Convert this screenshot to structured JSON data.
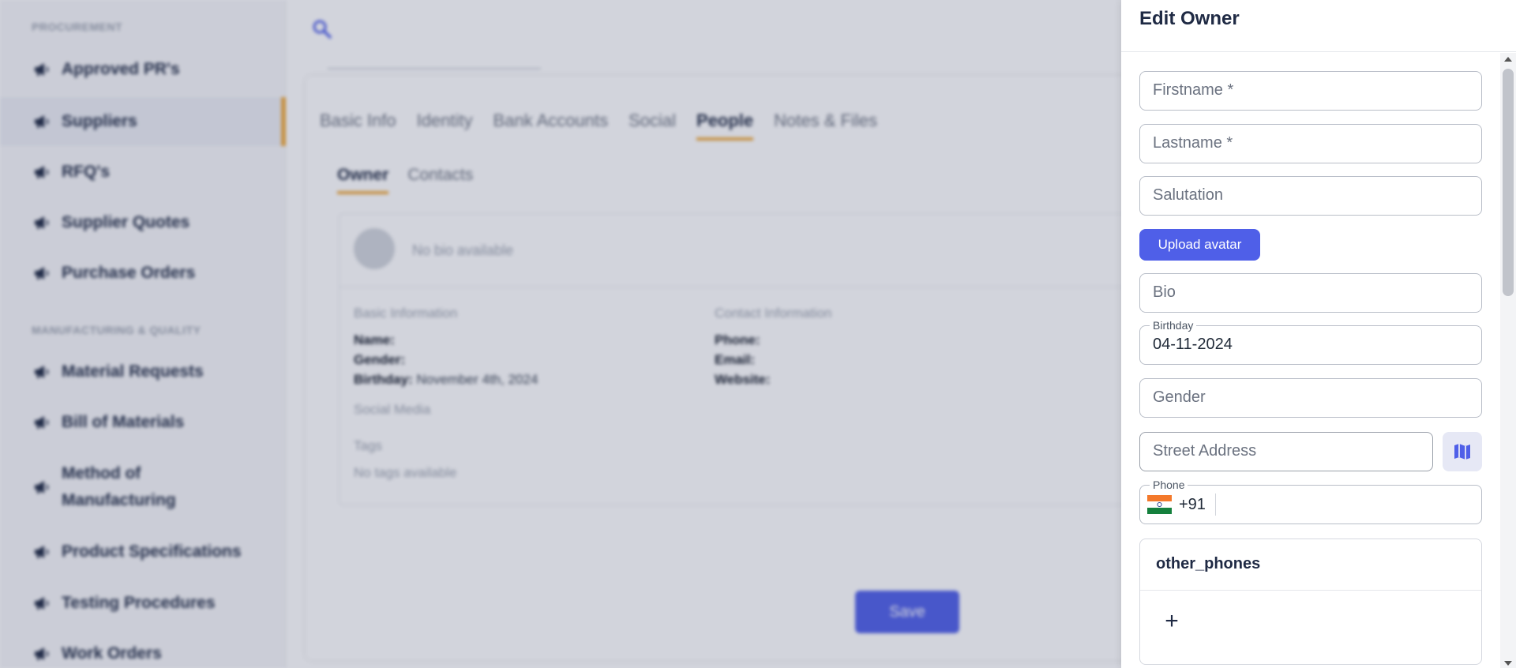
{
  "sidebar": {
    "section_procurement": "PROCUREMENT",
    "section_manufacturing": "MANUFACTURING & QUALITY",
    "items": [
      {
        "label": "Approved PR's"
      },
      {
        "label": "Suppliers"
      },
      {
        "label": "RFQ's"
      },
      {
        "label": "Supplier Quotes"
      },
      {
        "label": "Purchase Orders"
      },
      {
        "label": "Material Requests"
      },
      {
        "label": "Bill of Materials"
      },
      {
        "label": "Method of Manufacturing"
      },
      {
        "label": "Product Specifications"
      },
      {
        "label": "Testing Procedures"
      },
      {
        "label": "Work Orders"
      }
    ],
    "active_item": "Suppliers"
  },
  "main": {
    "tabs": [
      {
        "label": "Basic Info"
      },
      {
        "label": "Identity"
      },
      {
        "label": "Bank Accounts"
      },
      {
        "label": "Social"
      },
      {
        "label": "People"
      },
      {
        "label": "Notes & Files"
      }
    ],
    "active_tab": "People",
    "subtabs": [
      {
        "label": "Owner"
      },
      {
        "label": "Contacts"
      }
    ],
    "active_subtab": "Owner",
    "profile": {
      "no_bio": "No bio available",
      "basic_title": "Basic Information",
      "name_label": "Name:",
      "gender_label": "Gender:",
      "birthday_label": "Birthday:",
      "birthday_value": "November 4th, 2024",
      "social_title": "Social Media",
      "tags_title": "Tags",
      "no_tags": "No tags available",
      "contact_title": "Contact Information",
      "phone_label": "Phone:",
      "email_label": "Email:",
      "website_label": "Website:"
    },
    "save_label": "Save"
  },
  "drawer": {
    "title": "Edit Owner",
    "firstname_placeholder": "Firstname *",
    "lastname_placeholder": "Lastname *",
    "salutation_placeholder": "Salutation",
    "upload_label": "Upload avatar",
    "bio_placeholder": "Bio",
    "birthday_label": "Birthday",
    "birthday_value": "04-11-2024",
    "gender_placeholder": "Gender",
    "street_placeholder": "Street Address",
    "phone_label": "Phone",
    "phone_code": "+91",
    "other_phones_title": "other_phones",
    "add_icon": "+"
  },
  "colors": {
    "accent": "#4f5fe8",
    "tab_underline": "#f0a93b",
    "heading": "#1f2a44"
  },
  "icons": {
    "megaphone": "megaphone-icon",
    "search": "search-icon",
    "map": "map-icon",
    "flag": "india-flag-icon",
    "add": "plus-icon"
  }
}
